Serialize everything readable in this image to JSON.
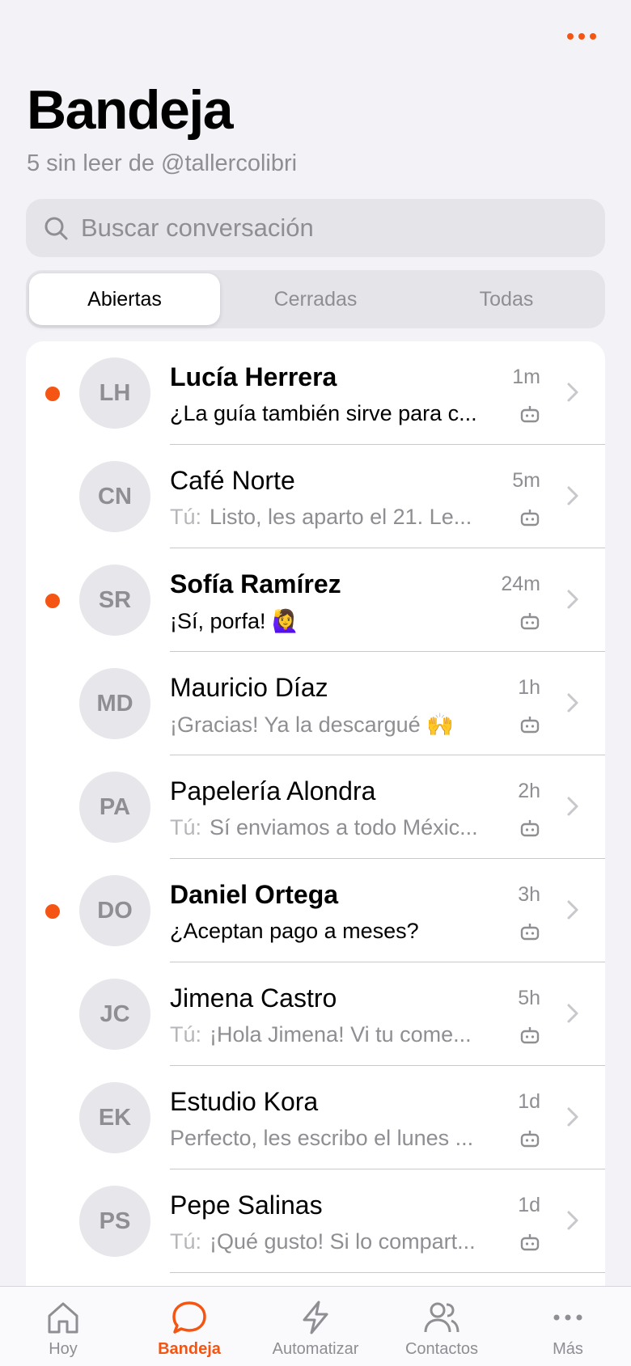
{
  "colors": {
    "accent": "#f45513",
    "background": "#f2f2f7",
    "secondary_text": "#8e8e93"
  },
  "header": {
    "menu_icon": "more-horizontal-icon",
    "title": "Bandeja",
    "subtitle": "5 sin leer de @tallercolibri"
  },
  "search": {
    "placeholder": "Buscar conversación",
    "value": "",
    "icon": "search-icon"
  },
  "filters": {
    "tabs": [
      "Abiertas",
      "Cerradas",
      "Todas"
    ],
    "selected": "Abiertas"
  },
  "conversations": [
    {
      "initials": "LH",
      "name": "Lucía Herrera",
      "time": "1m",
      "prefix": "",
      "preview": "¿La guía también sirve para c...",
      "unread": true
    },
    {
      "initials": "CN",
      "name": "Café Norte",
      "time": "5m",
      "prefix": "Tú:",
      "preview": "Listo, les aparto el 21. Le...",
      "unread": false
    },
    {
      "initials": "SR",
      "name": "Sofía Ramírez",
      "time": "24m",
      "prefix": "",
      "preview": "¡Sí, porfa! 🙋‍♀️",
      "unread": true
    },
    {
      "initials": "MD",
      "name": "Mauricio Díaz",
      "time": "1h",
      "prefix": "",
      "preview": "¡Gracias! Ya la descargué 🙌",
      "unread": false
    },
    {
      "initials": "PA",
      "name": "Papelería Alondra",
      "time": "2h",
      "prefix": "Tú:",
      "preview": "Sí enviamos a todo Méxic...",
      "unread": false
    },
    {
      "initials": "DO",
      "name": "Daniel Ortega",
      "time": "3h",
      "prefix": "",
      "preview": "¿Aceptan pago a meses?",
      "unread": true
    },
    {
      "initials": "JC",
      "name": "Jimena Castro",
      "time": "5h",
      "prefix": "Tú:",
      "preview": "¡Hola Jimena! Vi tu come...",
      "unread": false
    },
    {
      "initials": "EK",
      "name": "Estudio Kora",
      "time": "1d",
      "prefix": "",
      "preview": "Perfecto, les escribo el lunes ...",
      "unread": false
    },
    {
      "initials": "PS",
      "name": "Pepe Salinas",
      "time": "1d",
      "prefix": "Tú:",
      "preview": "¡Qué gusto! Si lo compart...",
      "unread": false
    }
  ],
  "row_icons": {
    "bot": "bot-icon",
    "chevron": "chevron-right-icon"
  },
  "tabbar": [
    {
      "label": "Hoy",
      "icon": "home-icon",
      "active": false
    },
    {
      "label": "Bandeja",
      "icon": "chat-bubble-icon",
      "active": true
    },
    {
      "label": "Automatizar",
      "icon": "lightning-icon",
      "active": false
    },
    {
      "label": "Contactos",
      "icon": "contacts-icon",
      "active": false
    },
    {
      "label": "Más",
      "icon": "more-horizontal-icon",
      "active": false
    }
  ]
}
